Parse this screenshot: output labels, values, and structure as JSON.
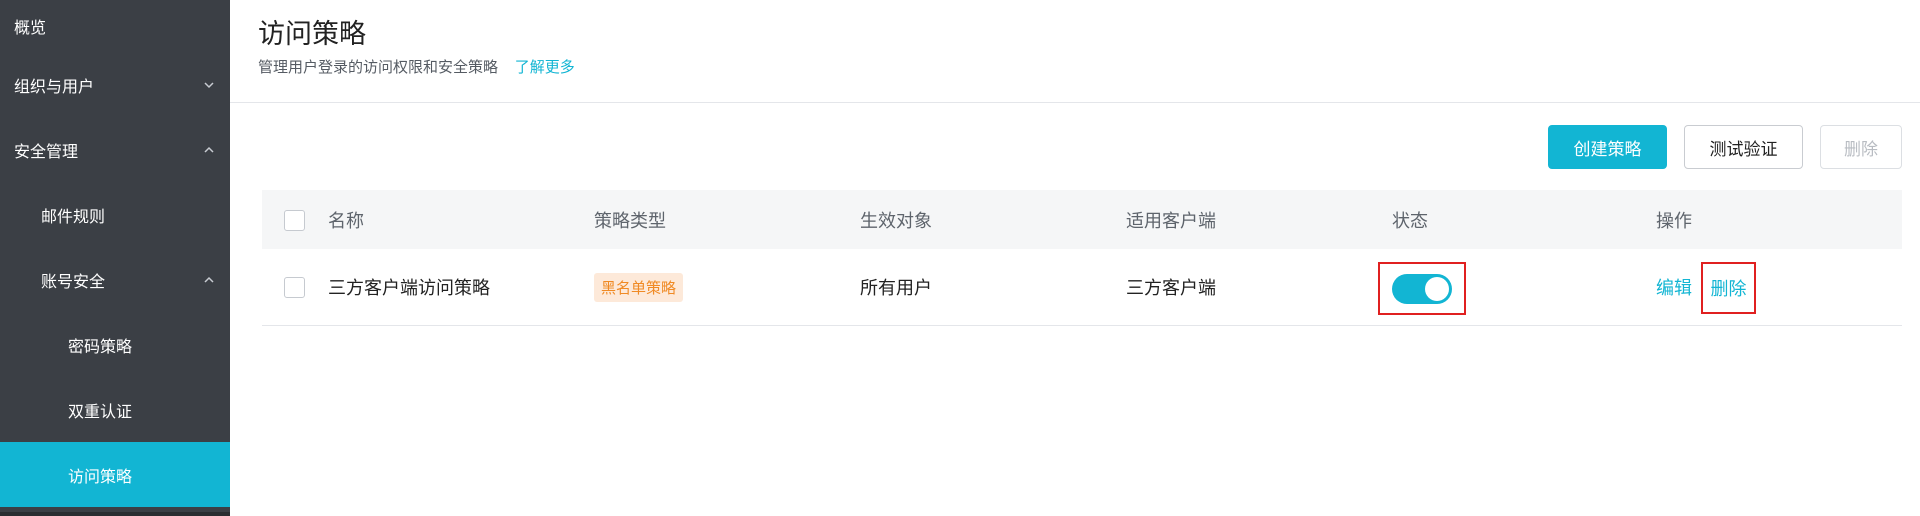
{
  "sidebar": {
    "items": [
      {
        "label": "概览"
      },
      {
        "label": "组织与用户",
        "chevron": "down"
      },
      {
        "label": "安全管理",
        "chevron": "up"
      },
      {
        "label": "邮件规则"
      },
      {
        "label": "账号安全",
        "chevron": "up"
      },
      {
        "label": "密码策略"
      },
      {
        "label": "双重认证"
      },
      {
        "label": "访问策略",
        "active": true
      }
    ]
  },
  "header": {
    "title": "访问策略",
    "subtitle": "管理用户登录的访问权限和安全策略",
    "learn_more": "了解更多"
  },
  "toolbar": {
    "create_label": "创建策略",
    "test_label": "测试验证",
    "delete_label": "删除"
  },
  "table": {
    "columns": [
      "名称",
      "策略类型",
      "生效对象",
      "适用客户端",
      "状态",
      "操作"
    ],
    "rows": [
      {
        "name": "三方客户端访问策略",
        "type": "黑名单策略",
        "target": "所有用户",
        "client": "三方客户端",
        "status_on": true,
        "edit": "编辑",
        "delete": "删除"
      }
    ]
  },
  "colors": {
    "accent": "#12b5d3",
    "sidebar_bg": "#3b3f45",
    "tag_bg": "#fde9d9",
    "tag_text": "#f08a24",
    "highlight": "#e02020"
  }
}
